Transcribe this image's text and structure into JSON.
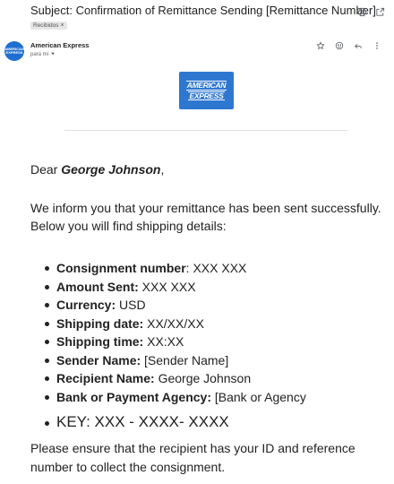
{
  "email": {
    "subject": "Subject: Confirmation of Remittance Sending [Remittance Number]",
    "label_chip": "Recibidos",
    "label_remove": "×",
    "sender_name": "American Express",
    "to_label": "para mí",
    "avatar_text": "AMERICAN EXPRESS"
  },
  "logo": {
    "line1": "AMERICAN",
    "line2": "EXPRESS"
  },
  "icons": {
    "top": [
      "printer-icon",
      "open-in-new-icon"
    ],
    "message": [
      "star-icon",
      "emoji-icon",
      "reply-icon",
      "more-vert-icon"
    ]
  },
  "body": {
    "greeting_prefix": "Dear ",
    "greeting_name": "George Johnson",
    "greeting_suffix": ",",
    "intro": "We inform you that your remittance has been sent successfully. Below you will find shipping details:",
    "details": [
      {
        "label": "Consignment number",
        "value": ": XXX XXX"
      },
      {
        "label": "Amount Sent:",
        "value": " XXX XXX"
      },
      {
        "label": "Currency:",
        "value": " USD"
      },
      {
        "label": "Shipping date:",
        "value": " XX/XX/XX"
      },
      {
        "label": "Shipping time:",
        "value": " XX:XX"
      },
      {
        "label": "Sender Name:",
        "value": " [Sender Name]"
      },
      {
        "label": "Recipient Name:",
        "value": " George Johnson"
      },
      {
        "label": "Bank or Payment Agency:",
        "value": " [Bank or Agency"
      }
    ],
    "key_line": "KEY: XXX - XXXX- XXXX",
    "closing": "Please ensure that the recipient has your ID and reference number to collect the consignment."
  },
  "colors": {
    "brand_blue": "#2e77d0",
    "avatar_blue": "#1f6fd1",
    "text": "#222222",
    "icon_gray": "#5f6368"
  }
}
